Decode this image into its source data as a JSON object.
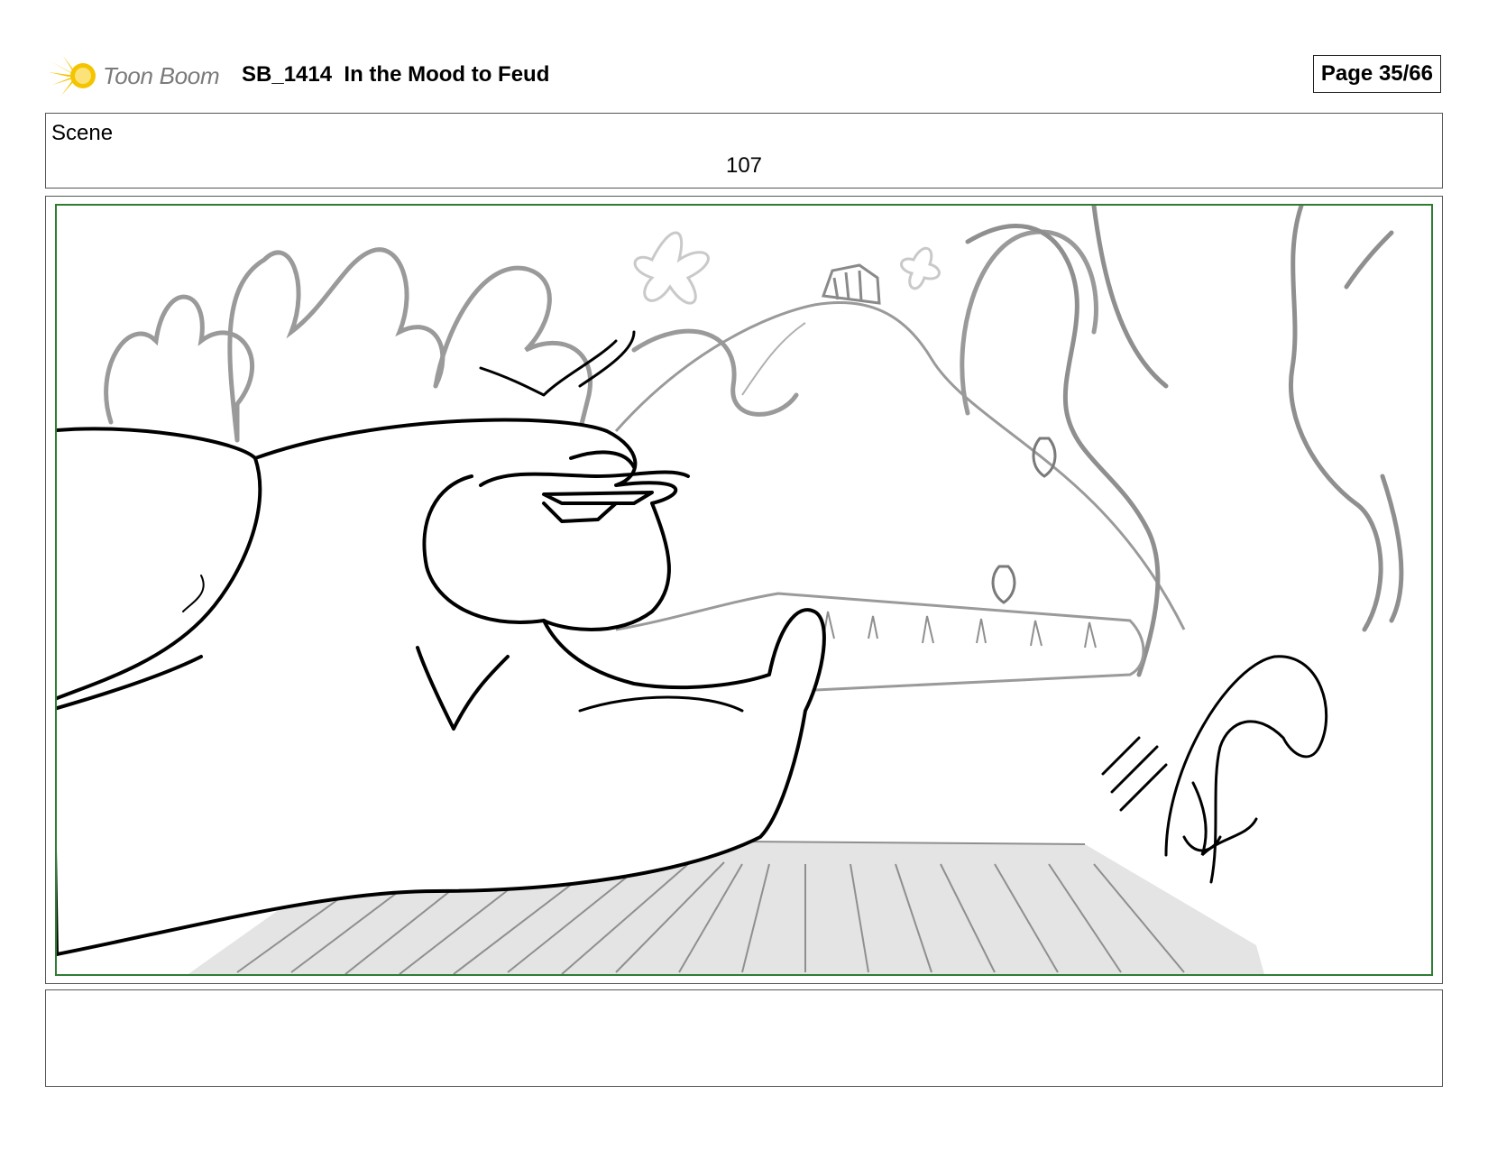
{
  "header": {
    "logo_text": "Toon Boom",
    "logo_icon": "toon-boom-burst-icon",
    "title": "SB_1414  In the Mood to Feud",
    "page": "Page 35/66"
  },
  "scene": {
    "label": "Scene",
    "number": "107"
  },
  "panel": {
    "frame_color": "#2e7d32",
    "drawing": "storyboard-sketch"
  },
  "notes": {
    "text": ""
  }
}
